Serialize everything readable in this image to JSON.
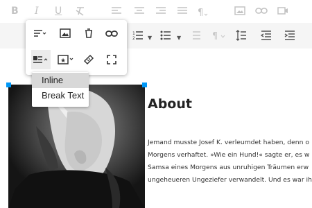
{
  "toolbar_row1": {
    "icons": [
      "bold-icon",
      "italic-icon",
      "underline-icon",
      "clear-format-icon",
      "align-left-icon",
      "align-center-icon",
      "align-right-icon",
      "align-justify-icon",
      "paragraph-format-icon",
      "insert-image-icon",
      "insert-link-icon",
      "insert-video-icon"
    ],
    "bold_label": "B",
    "italic_label": "I",
    "underline_label": "U"
  },
  "toolbar_row2": {
    "icons": [
      "ordered-list-icon",
      "unordered-list-icon",
      "indent-list-icon",
      "paragraph-icon",
      "line-height-icon",
      "outdent-icon",
      "indent-icon"
    ]
  },
  "image_popup": {
    "row1": [
      "image-align-icon",
      "replace-image-icon",
      "delete-image-icon",
      "image-link-icon"
    ],
    "row2": [
      "image-display-icon",
      "image-style-icon",
      "image-alt-icon",
      "image-size-icon"
    ]
  },
  "display_dropdown": {
    "options": [
      "Inline",
      "Break Text"
    ],
    "highlighted": "Inline"
  },
  "content": {
    "heading": "About",
    "paragraph_lines": [
      "Jemand musste Josef K. verleumdet haben, denn o",
      "Morgens verhaftet. »Wie ein Hund!« sagte er, es w",
      "Samsa eines Morgens aus unruhigen Träumen erw",
      "ungeheueren Ungeziefer verwandelt. Und es war ih"
    ]
  },
  "colors": {
    "accent": "#0098f7",
    "toolbar_bg": "#f5f5f5",
    "icon_muted": "#c3c3c3",
    "icon_dark": "#333333"
  }
}
